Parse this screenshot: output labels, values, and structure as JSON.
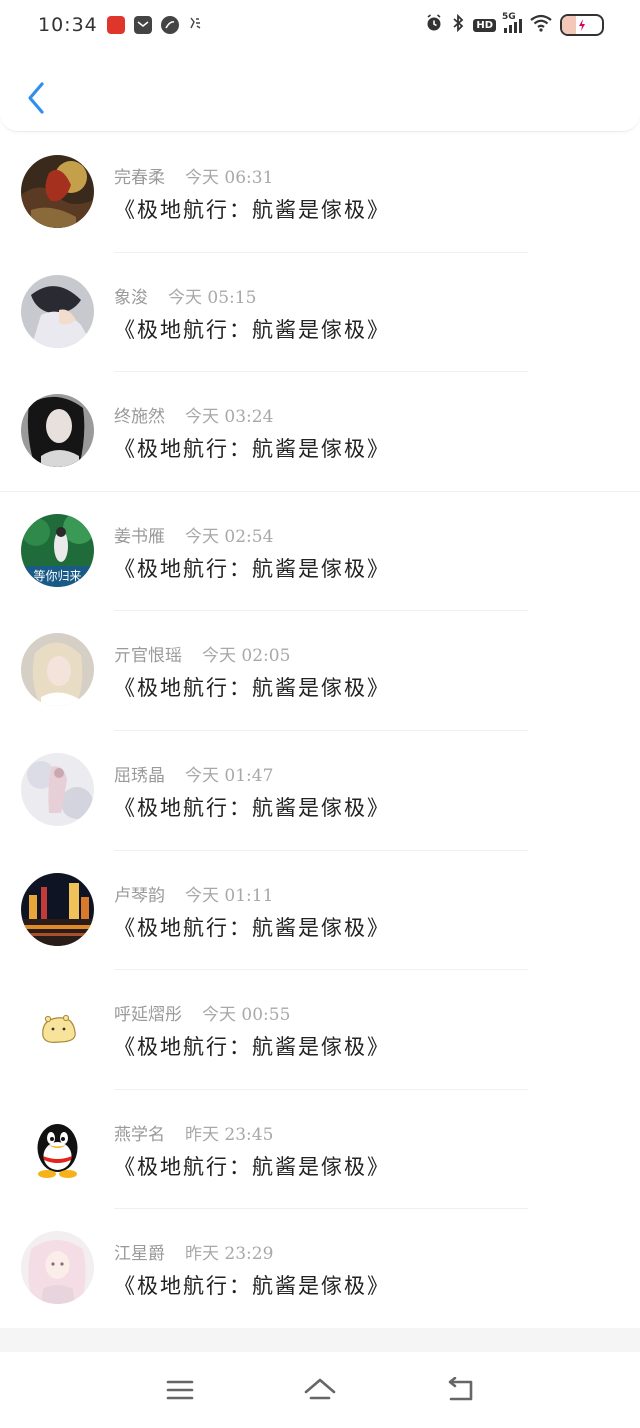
{
  "status_bar": {
    "time": "10:34",
    "network": "5G",
    "hd": "HD"
  },
  "header": {
    "back_icon": "chevron-left-icon",
    "accent_color": "#2f8ff0"
  },
  "messages": [
    {
      "name": "完春柔",
      "time": "今天 06:31",
      "text": "《极地航行：航酱是傢极》"
    },
    {
      "name": "象浚",
      "time": "今天 05:15",
      "text": "《极地航行：航酱是傢极》"
    },
    {
      "name": "终施然",
      "time": "今天 03:24",
      "text": "《极地航行：航酱是傢极》"
    },
    {
      "name": "姜书雁",
      "time": "今天 02:54",
      "text": "《极地航行：航酱是傢极》"
    },
    {
      "name": "亓官恨瑶",
      "time": "今天 02:05",
      "text": "《极地航行：航酱是傢极》"
    },
    {
      "name": "屈琇晶",
      "time": "今天 01:47",
      "text": "《极地航行：航酱是傢极》"
    },
    {
      "name": "卢琴韵",
      "time": "今天 01:11",
      "text": "《极地航行：航酱是傢极》"
    },
    {
      "name": "呼延熠彤",
      "time": "今天 00:55",
      "text": "《极地航行：航酱是傢极》"
    },
    {
      "name": "燕学名",
      "time": "昨天 23:45",
      "text": "《极地航行：航酱是傢极》"
    },
    {
      "name": "江星爵",
      "time": "昨天 23:29",
      "text": "《极地航行：航酱是傢极》"
    }
  ],
  "avatar_texts": {
    "avatar_3": "等你归来"
  },
  "nav": {
    "menu_icon": "menu-icon",
    "home_icon": "home-icon",
    "back_icon": "back-icon"
  }
}
